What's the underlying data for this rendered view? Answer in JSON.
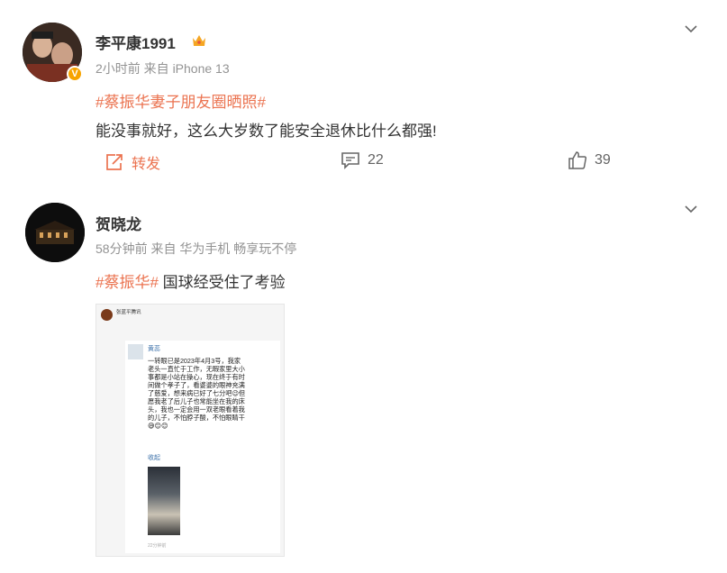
{
  "post1": {
    "username": "李平康1991",
    "meta": "2小时前 来自 iPhone 13",
    "hashtag": "#蔡振华妻子朋友圈晒照#",
    "text": "能没事就好，这么大岁数了能安全退休比什么都强!",
    "repost_label": "转发",
    "comment_count": "22",
    "like_count": "39"
  },
  "post2": {
    "username": "贺晓龙",
    "meta": "58分钟前 来自 华为手机 畅享玩不停",
    "hashtag": "#蔡振华#",
    "text": " 国球经受住了考验",
    "screenshot": {
      "top_name": "张蓝平腾讯",
      "commenter": "黄蕊",
      "lines": [
        "一转眼已是2023年4月3号，我家",
        "老头一直忙于工作，无暇家里大小",
        "事都是小站在操心，现在终于有时",
        "间做个孝子了，看婆婆的眼神充满",
        "了慈爱，想来病已好了七分吧😉但",
        "愿我老了后儿子也常能坐在我的床",
        "头，我也一定会用一双老眼看着我",
        "的儿子，不怕脖子酸，不怕眼睛干",
        "😅😊😊"
      ],
      "collapse": "收起",
      "time": "22分钟前"
    }
  }
}
